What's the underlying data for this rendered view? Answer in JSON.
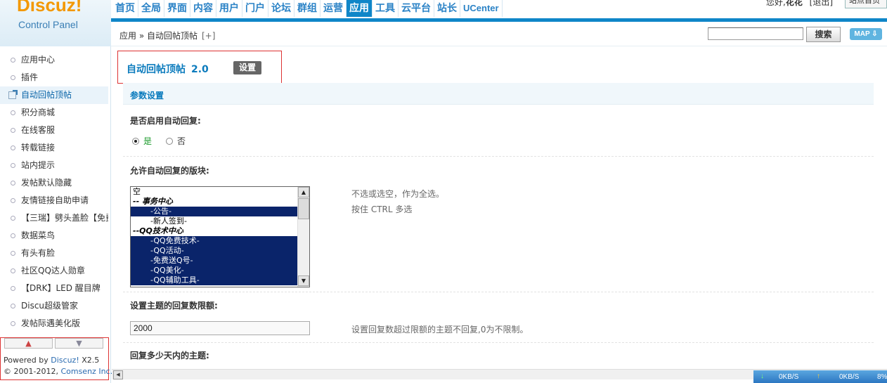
{
  "logo": {
    "brand": "Discuz!",
    "subtitle": "Control Panel"
  },
  "topnav": [
    "首页",
    "全局",
    "界面",
    "内容",
    "用户",
    "门户",
    "论坛",
    "群组",
    "运营",
    "应用",
    "工具",
    "云平台",
    "站长",
    "UCenter"
  ],
  "topnav_active": "应用",
  "user": {
    "greeting": "您好,",
    "name": "花花",
    "logout": "[退出]",
    "site_home": "站点首页"
  },
  "breadcrumb": {
    "text": "应用 » 自动回帖顶帖",
    "plus": "[+]"
  },
  "search": {
    "value": "",
    "button": "搜索"
  },
  "map_button": "MAP ⇩",
  "sidebar": {
    "items": [
      "应用中心",
      "插件",
      "自动回帖顶帖",
      "积分商城",
      "在线客服",
      "转载链接",
      "站内提示",
      "发帖默认隐藏",
      "友情链接自助申请",
      "【三瑞】劈头盖脸【免费】",
      "数据菜鸟",
      "有头有脸",
      "社区QQ达人勋章",
      "【DRK】LED 醒目牌",
      "Discu超级管家",
      "发帖际遇美化版"
    ],
    "active": "自动回帖顶帖"
  },
  "powered": {
    "prefix": "Powered by ",
    "product": "Discuz!",
    "version": " X2.5",
    "copy": "© 2001-2012, ",
    "company": "Comsenz Inc."
  },
  "plugin": {
    "name": "自动回帖顶帖",
    "version": "2.0",
    "tab": "设置"
  },
  "section": {
    "title": "参数设置"
  },
  "fields": {
    "enable_label": "是否启用自动回复:",
    "yes": "是",
    "no": "否",
    "forums_label": "允许自动回复的版块:",
    "forums_hint1": "不选或选空，作为全选。",
    "forums_hint2": "按住  CTRL 多选",
    "limit_label": "设置主题的回复数限额:",
    "limit_value": "2000",
    "limit_hint": "设置回复数超过限额的主题不回复,0为不限制。",
    "days_label": "回复多少天内的主题:"
  },
  "forum_options": [
    {
      "label": "空",
      "type": "plain",
      "selected": false
    },
    {
      "label": "-- 事务中心",
      "type": "group",
      "selected": false
    },
    {
      "label": "-公告-",
      "type": "child",
      "selected": true
    },
    {
      "label": "-新人签到-",
      "type": "child",
      "selected": false
    },
    {
      "label": "--QQ技术中心",
      "type": "group",
      "selected": false
    },
    {
      "label": "-QQ免费技术-",
      "type": "child",
      "selected": true
    },
    {
      "label": "-QQ活动-",
      "type": "child",
      "selected": true
    },
    {
      "label": "-免费送Q号-",
      "type": "child",
      "selected": true
    },
    {
      "label": "-QQ美化-",
      "type": "child",
      "selected": true
    },
    {
      "label": "-QQ辅助工具-",
      "type": "child",
      "selected": true
    }
  ],
  "netspeed": {
    "down": "0KB/S",
    "up": "0KB/S",
    "pct": "8%"
  }
}
